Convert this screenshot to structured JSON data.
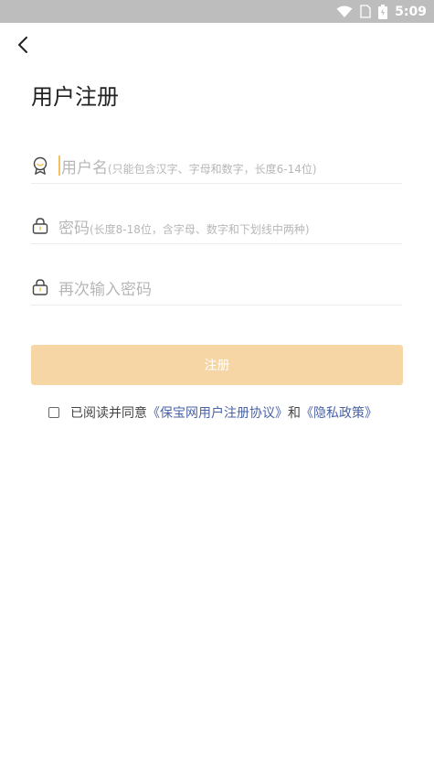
{
  "status_bar": {
    "time": "5:09",
    "icons": [
      "wifi-icon",
      "sim-icon",
      "battery-icon"
    ]
  },
  "nav": {
    "back_icon": "chevron-left-icon"
  },
  "page": {
    "title": "用户注册"
  },
  "form": {
    "username": {
      "icon": "badge-icon",
      "placeholder_main": "用户名",
      "placeholder_hint": "(只能包含汉字、字母和数字，长度6-14位)"
    },
    "password": {
      "icon": "lock-icon",
      "placeholder_main": "密码",
      "placeholder_hint": "(长度8-18位，含字母、数字和下划线中两种)"
    },
    "password_confirm": {
      "icon": "lock-icon",
      "placeholder_main": "再次输入密码"
    },
    "submit_label": "注册"
  },
  "agreement": {
    "prefix": "已阅读并同意",
    "link1": "《保宝网用户注册协议》",
    "conjunction": "和",
    "link2": "《隐私政策》"
  },
  "colors": {
    "accent": "#f2c05d",
    "button": "#f7d6a6",
    "link": "#4a63a6",
    "status_bar": "#bdbdbd"
  }
}
